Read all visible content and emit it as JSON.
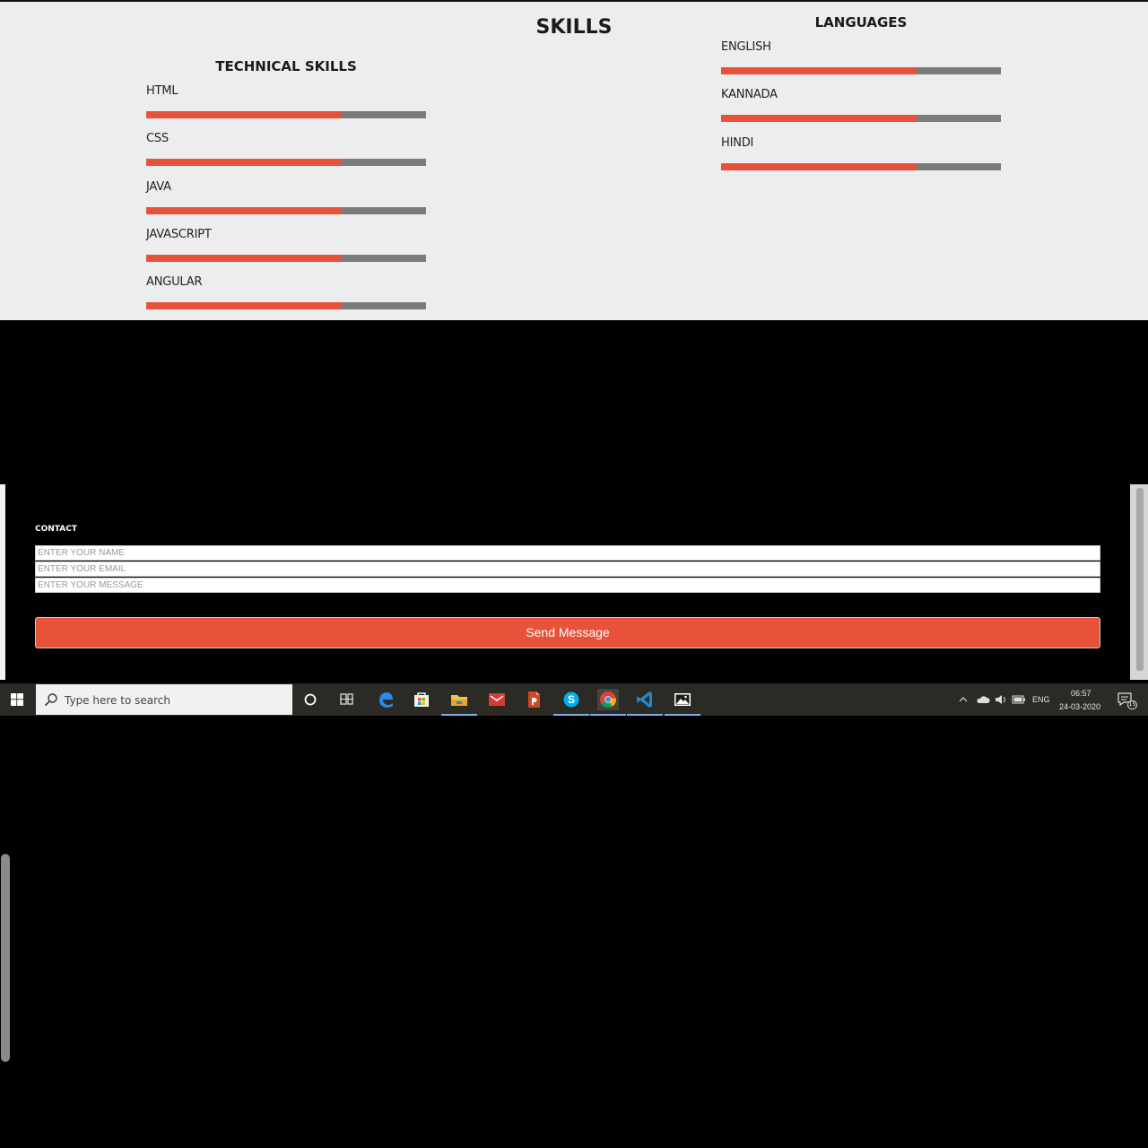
{
  "skills": {
    "title": "SKILLS",
    "technical": {
      "heading": "TECHNICAL SKILLS",
      "items": [
        {
          "name": "HTML",
          "level": 0.7
        },
        {
          "name": "CSS",
          "level": 0.7
        },
        {
          "name": "JAVA",
          "level": 0.7
        },
        {
          "name": "JAVASCRIPT",
          "level": 0.7
        },
        {
          "name": "ANGULAR",
          "level": 0.7
        }
      ]
    },
    "languages": {
      "heading": "LANGUAGES",
      "items": [
        {
          "name": "ENGLISH",
          "level": 0.7
        },
        {
          "name": "KANNADA",
          "level": 0.7
        },
        {
          "name": "HINDI",
          "level": 0.7
        }
      ]
    },
    "colors": {
      "fill": "#e8523a",
      "track": "#7b7b7b"
    }
  },
  "contact": {
    "label": "CONTACT",
    "name_placeholder": "ENTER YOUR NAME",
    "email_placeholder": "ENTER YOUR EMAIL",
    "message_placeholder": "ENTER YOUR MESSAGE",
    "send_label": "Send Message",
    "accent": "#e8523a"
  },
  "taskbar": {
    "search_placeholder": "Type here to search",
    "apps": [
      "cortana-icon",
      "task-view-icon",
      "edge-icon",
      "store-icon",
      "file-explorer-icon",
      "mail-app-icon",
      "powerpoint-icon",
      "skype-icon",
      "chrome-icon",
      "vscode-icon",
      "photos-icon"
    ],
    "tray": {
      "language": "ENG",
      "time": "06:57",
      "date": "24-03-2020",
      "notification_count": "15"
    }
  }
}
